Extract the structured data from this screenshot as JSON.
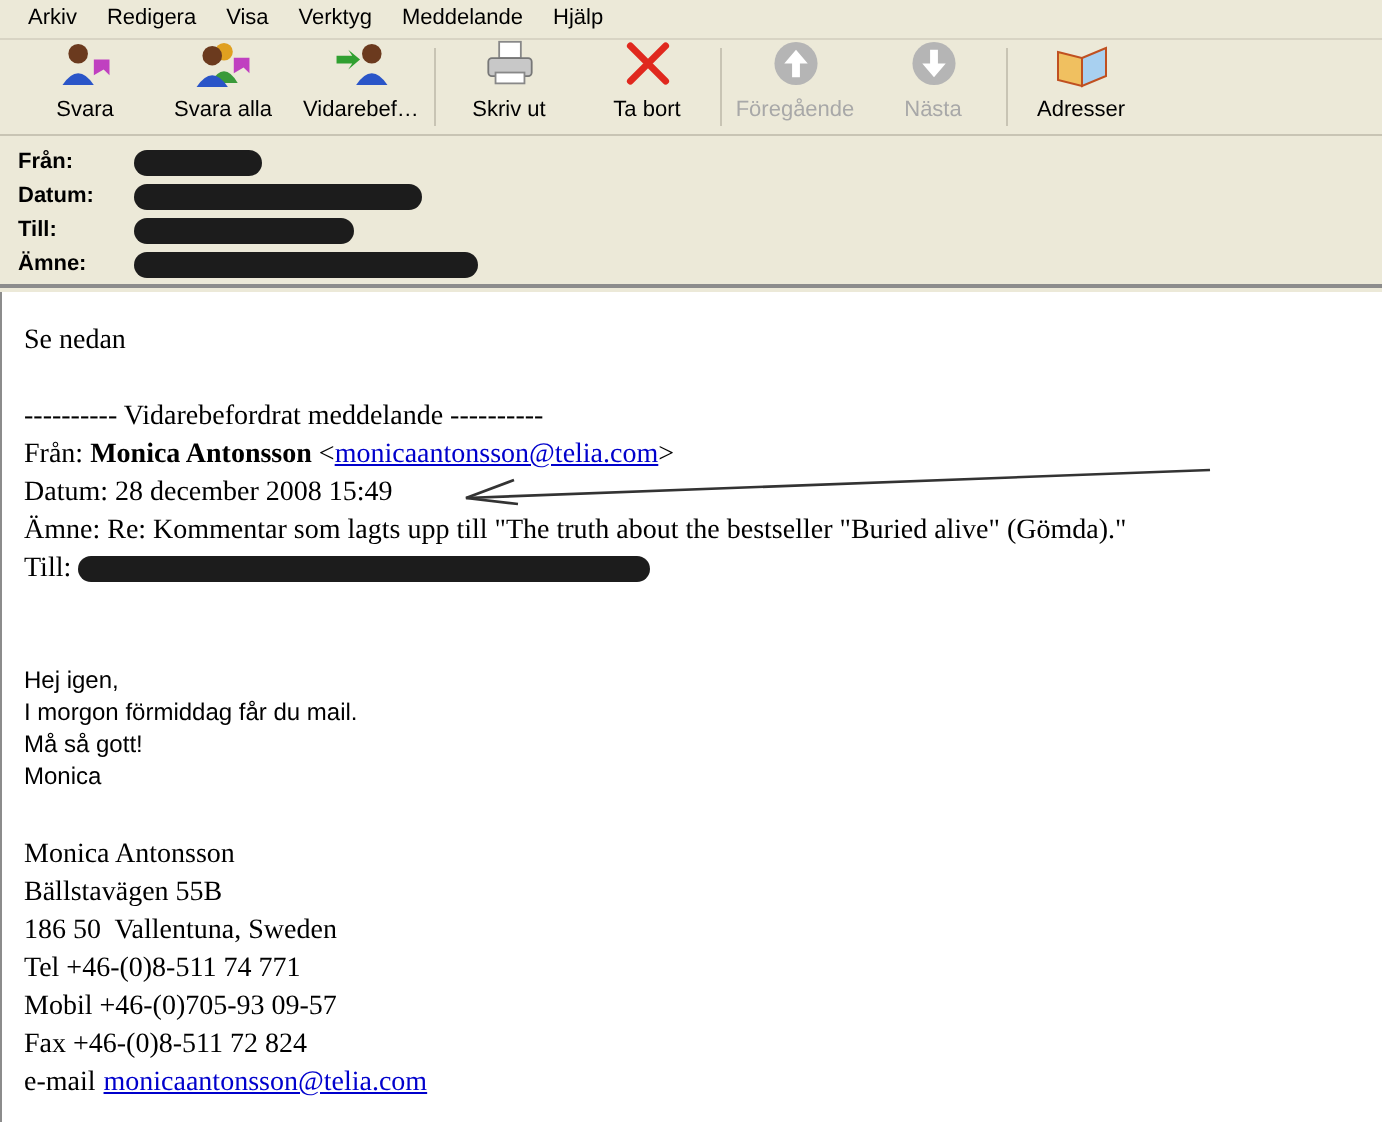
{
  "menu": [
    "Arkiv",
    "Redigera",
    "Visa",
    "Verktyg",
    "Meddelande",
    "Hjälp"
  ],
  "toolbar": [
    {
      "kind": "reply",
      "label": "Svara",
      "disabled": false
    },
    {
      "kind": "reply_all",
      "label": "Svara alla",
      "disabled": false
    },
    {
      "kind": "forward",
      "label": "Vidarebef…",
      "disabled": false
    },
    {
      "kind": "separator"
    },
    {
      "kind": "print",
      "label": "Skriv ut",
      "disabled": false
    },
    {
      "kind": "delete",
      "label": "Ta bort",
      "disabled": false
    },
    {
      "kind": "separator"
    },
    {
      "kind": "previous",
      "label": "Föregående",
      "disabled": true
    },
    {
      "kind": "next",
      "label": "Nästa",
      "disabled": true
    },
    {
      "kind": "separator"
    },
    {
      "kind": "addresses",
      "label": "Adresser",
      "disabled": false
    }
  ],
  "header": [
    {
      "label": "Från:"
    },
    {
      "label": "Datum:"
    },
    {
      "label": "Till:"
    },
    {
      "label": "Ämne:"
    }
  ],
  "body": {
    "intro": "Se nedan",
    "forwarded": [
      {
        "kind": "text",
        "text": "---------- Vidarebefordrat meddelande ----------"
      },
      {
        "kind": "from",
        "label": "Från:",
        "name": "Monica Antonsson",
        "open": "<",
        "email": "monicaantonsson@telia.com",
        "close": ">"
      },
      {
        "kind": "text",
        "text": "Datum: 28 december 2008 15:49"
      },
      {
        "kind": "text",
        "text": "Ämne: Re: Kommentar som lagts upp till \"The truth about the bestseller \"Buried alive\" (Gömda).\""
      },
      {
        "kind": "redacted",
        "label": "Till:"
      }
    ],
    "message": [
      "Hej igen,",
      "I morgon förmiddag får du mail.",
      "Må så gott!",
      "Monica"
    ],
    "signature": [
      {
        "kind": "text",
        "text": "Monica Antonsson"
      },
      {
        "kind": "text",
        "text": "Bällstavägen 55B"
      },
      {
        "kind": "text",
        "text": "186 50  Vallentuna, Sweden"
      },
      {
        "kind": "text",
        "text": "Tel +46-(0)8-511 74 771"
      },
      {
        "kind": "text",
        "text": "Mobil +46-(0)705-93 09-57"
      },
      {
        "kind": "text",
        "text": "Fax +46-(0)8-511 72 824"
      },
      {
        "kind": "email",
        "label": "e-mail",
        "email": "monicaantonsson@telia.com"
      }
    ]
  }
}
